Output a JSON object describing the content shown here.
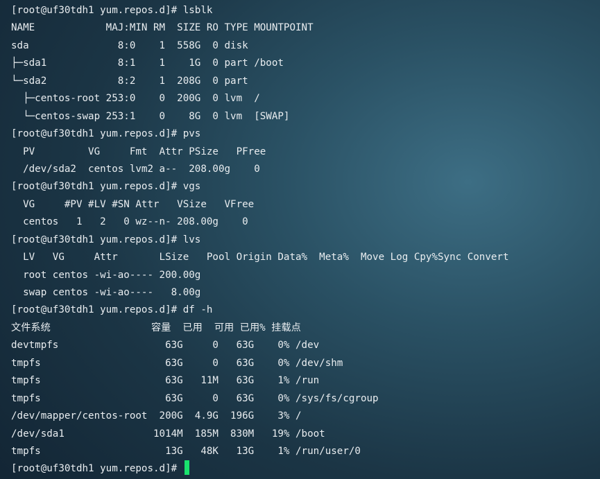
{
  "terminal": {
    "cursor_color": "#19e36e",
    "lines": [
      "[root@uf30tdh1 yum.repos.d]# lsblk",
      "NAME            MAJ:MIN RM  SIZE RO TYPE MOUNTPOINT",
      "sda               8:0    1  558G  0 disk",
      "├─sda1            8:1    1    1G  0 part /boot",
      "└─sda2            8:2    1  208G  0 part",
      "  ├─centos-root 253:0    0  200G  0 lvm  /",
      "  └─centos-swap 253:1    0    8G  0 lvm  [SWAP]",
      "[root@uf30tdh1 yum.repos.d]# pvs",
      "  PV         VG     Fmt  Attr PSize   PFree",
      "  /dev/sda2  centos lvm2 a--  208.00g    0",
      "[root@uf30tdh1 yum.repos.d]# vgs",
      "  VG     #PV #LV #SN Attr   VSize   VFree",
      "  centos   1   2   0 wz--n- 208.00g    0",
      "[root@uf30tdh1 yum.repos.d]# lvs",
      "  LV   VG     Attr       LSize   Pool Origin Data%  Meta%  Move Log Cpy%Sync Convert",
      "  root centos -wi-ao---- 200.00g",
      "  swap centos -wi-ao----   8.00g",
      "[root@uf30tdh1 yum.repos.d]# df -h",
      "文件系统                 容量  已用  可用 已用% 挂载点",
      "devtmpfs                  63G     0   63G    0% /dev",
      "tmpfs                     63G     0   63G    0% /dev/shm",
      "tmpfs                     63G   11M   63G    1% /run",
      "tmpfs                     63G     0   63G    0% /sys/fs/cgroup",
      "/dev/mapper/centos-root  200G  4.9G  196G    3% /",
      "/dev/sda1               1014M  185M  830M   19% /boot",
      "tmpfs                     13G   48K   13G    1% /run/user/0"
    ],
    "prompt": "[root@uf30tdh1 yum.repos.d]# "
  }
}
